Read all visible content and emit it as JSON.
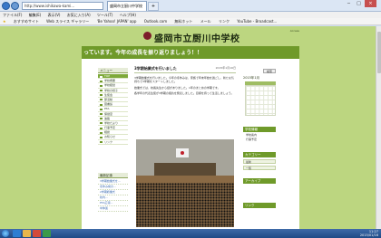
{
  "browser": {
    "url": "http://www.ishikawa-kami...",
    "tab_title": "盛岡市立厨川中学校",
    "menu": [
      "ファイル(F)",
      "編集(E)",
      "表示(V)",
      "お気に入り(A)",
      "ツール(T)",
      "ヘルプ(H)"
    ],
    "favorites": [
      "おすすめサイト",
      "Web スライス ギャラリー",
      "'Be Yahoo! JAPAN' app",
      "Outlook.com",
      "無料ホット",
      "メール",
      "リンク",
      "YouTube - Broadcast..."
    ]
  },
  "header": {
    "school_name": "盛岡市立厨川中学校",
    "banner_text": "っています。今年の成長を振り返りましょう！！",
    "right_info": "Access"
  },
  "sidebar": {
    "title": "メニュー",
    "items": [
      "TOP",
      "学校概要",
      "学校経営",
      "学校の様子",
      "生徒会",
      "部活動",
      "図書館",
      "PTA",
      "保健室",
      "進路",
      "学校だより",
      "行事予定",
      "相談",
      "お知らせ",
      "リンク"
    ],
    "recent_title": "最新記事",
    "recent": [
      "3学期始業式を…",
      "冬休み前の…",
      "2学期終業式",
      "校内…",
      "PTA広報…",
      "中体連"
    ]
  },
  "article": {
    "title": "3学期始業式を行いました",
    "date": "2015年1月16日",
    "paragraphs": [
      "3学期始業式を行いました。今年の冬休みは、家族で年末年始を過ごし、新たな気持ちで3学期をスタートしました。",
      "始業式では、校長先生から話がありました。1年のまとめの学期です。",
      "各学年の代表生徒が3学期の抱負を発表しました。目標を持って生活しましょう。"
    ]
  },
  "rightcol": {
    "search_label": "検索",
    "calendar_title": "2015年1月",
    "boxes": [
      "学校情報",
      "カテゴリー",
      "アーカイブ",
      "リンク"
    ],
    "links": [
      "学校案内",
      "行事予定"
    ],
    "buttons": [
      "最新",
      "一覧"
    ]
  },
  "taskbar": {
    "time": "11:27",
    "date": "2015/01/16"
  }
}
